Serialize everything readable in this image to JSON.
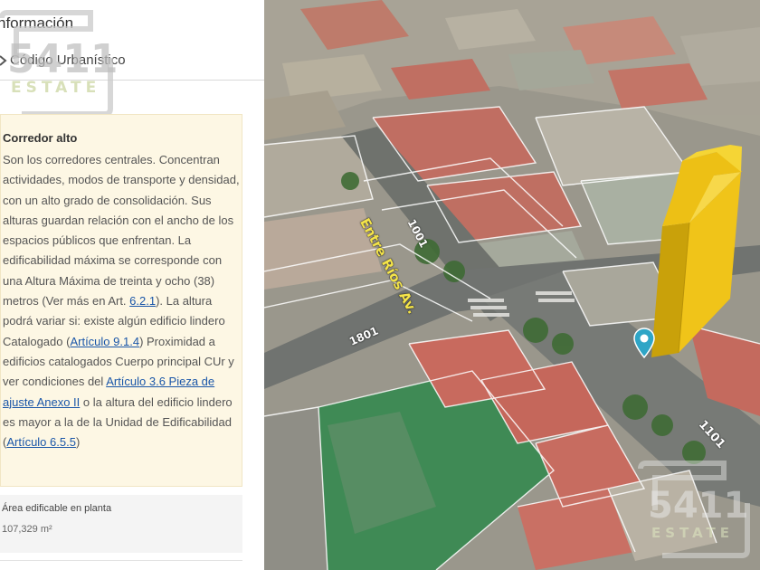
{
  "panel": {
    "title": "nformación",
    "breadcrumb": "Código Urbanístico"
  },
  "zone": {
    "name": "Corredor alto",
    "description": [
      {
        "text": "Son los corredores centrales. Concentran actividades, modos de transporte y densidad, con un alto grado de consolidación. Sus alturas guardan relación con el ancho de los espacios públicos que enfrentan. La edificabilidad máxima se corresponde con una Altura Máxima de treinta y ocho (38) metros (Ver más en Art. "
      },
      {
        "link": "6.2.1"
      },
      {
        "text": "). La altura podrá variar si: existe algún edificio lindero Catalogado ("
      },
      {
        "link": "Artículo 9.1.4"
      },
      {
        "text": ") Proximidad a edificios catalogados Cuerpo principal CUr y ver condiciones del "
      },
      {
        "link": "Artículo 3.6 Pieza de ajuste Anexo II"
      },
      {
        "text": " o la altura del edificio lindero es mayor a la de la Unidad de Edificabilidad ("
      },
      {
        "link": "Artículo 6.5.5"
      },
      {
        "text": ")"
      }
    ]
  },
  "area": {
    "label": "Área edificable en planta",
    "value": "107,329 m²"
  },
  "watermark": {
    "number": "5411",
    "word": "ESTATE"
  },
  "map": {
    "street_name": "Entre Ríos Av.",
    "street_numbers": [
      "1001",
      "1801",
      "1101"
    ]
  },
  "colors": {
    "zone_card_bg": "#fdf7e4",
    "link": "#1a56a8",
    "building_volume": "#f0c419",
    "pin": "#2fa5c6"
  },
  "icons": {
    "breadcrumb": "chevron-right-icon",
    "location": "map-pin-icon"
  }
}
